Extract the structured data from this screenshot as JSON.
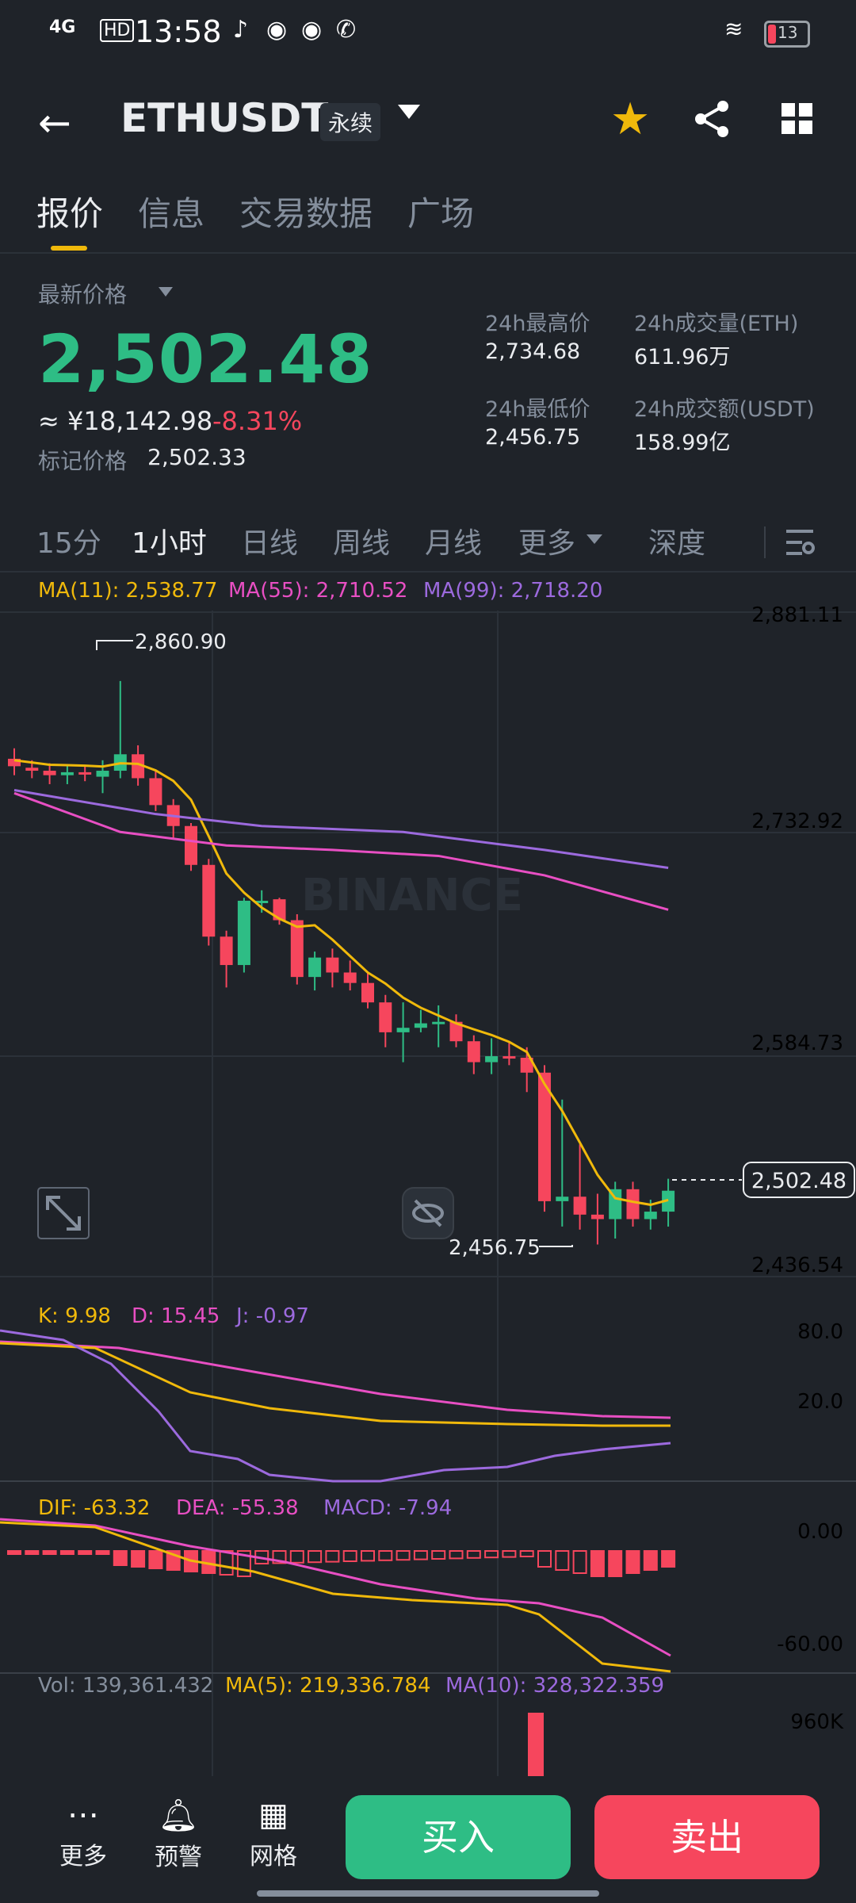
{
  "status": {
    "signal": "4G",
    "hd": "HD",
    "time": "13:58",
    "battery": "13"
  },
  "header": {
    "pair": "ETHUSDT",
    "contract_tag": "永续"
  },
  "tabs": [
    "报价",
    "信息",
    "交易数据",
    "广场"
  ],
  "quote": {
    "latest_label": "最新价格",
    "price": "2,502.48",
    "cny": "≈ ¥18,142.98",
    "change": "-8.31%",
    "mark_label": "标记价格",
    "mark_value": "2,502.33",
    "high_label": "24h最高价",
    "high_value": "2,734.68",
    "low_label": "24h最低价",
    "low_value": "2,456.75",
    "vol_label": "24h成交量(ETH)",
    "vol_value": "611.96万",
    "turnover_label": "24h成交额(USDT)",
    "turnover_value": "158.99亿"
  },
  "intervals": [
    "15分",
    "1小时",
    "日线",
    "周线",
    "月线",
    "更多",
    "深度"
  ],
  "colors": {
    "up": "#2ebd85",
    "down": "#f6465d",
    "accent": "#f0b90b",
    "ma11": "#f0b90b",
    "ma55": "#e84fc3",
    "ma99": "#9c6ade"
  },
  "chart_data": {
    "type": "candlestick",
    "ma_labels": {
      "ma11": "MA(11): 2,538.77",
      "ma55": "MA(55): 2,710.52",
      "ma99": "MA(99): 2,718.20"
    },
    "y_ticks": [
      "2,881.11",
      "2,732.92",
      "2,584.73",
      "2,436.54"
    ],
    "y_tick_values": [
      2881.11,
      2732.92,
      2584.73,
      2436.54
    ],
    "high_marker": "2,860.90",
    "low_marker": "2,456.75",
    "last_price": "2,502.48",
    "watermark": "BINANCE",
    "candles": [
      [
        2783,
        2778,
        2790,
        2772
      ],
      [
        2777,
        2775,
        2782,
        2770
      ],
      [
        2775,
        2772,
        2780,
        2766
      ],
      [
        2772,
        2774,
        2778,
        2766
      ],
      [
        2774,
        2773,
        2779,
        2768
      ],
      [
        2771,
        2775,
        2782,
        2760
      ],
      [
        2775,
        2786,
        2835,
        2770
      ],
      [
        2786,
        2770,
        2792,
        2765
      ],
      [
        2770,
        2752,
        2775,
        2748
      ],
      [
        2752,
        2738,
        2756,
        2730
      ],
      [
        2738,
        2712,
        2740,
        2708
      ],
      [
        2712,
        2664,
        2716,
        2658
      ],
      [
        2664,
        2645,
        2668,
        2630
      ],
      [
        2645,
        2688,
        2690,
        2640
      ],
      [
        2688,
        2688,
        2695,
        2680
      ],
      [
        2689,
        2675,
        2690,
        2672
      ],
      [
        2675,
        2637,
        2679,
        2632
      ],
      [
        2637,
        2650,
        2654,
        2628
      ],
      [
        2650,
        2640,
        2656,
        2630
      ],
      [
        2640,
        2633,
        2648,
        2628
      ],
      [
        2633,
        2620,
        2640,
        2616
      ],
      [
        2620,
        2600,
        2625,
        2590
      ],
      [
        2600,
        2603,
        2620,
        2580
      ],
      [
        2603,
        2606,
        2615,
        2600
      ],
      [
        2606,
        2607,
        2618,
        2590
      ],
      [
        2607,
        2594,
        2612,
        2590
      ],
      [
        2594,
        2580,
        2598,
        2572
      ],
      [
        2580,
        2584,
        2596,
        2572
      ],
      [
        2584,
        2583,
        2594,
        2578
      ],
      [
        2583,
        2573,
        2590,
        2560
      ],
      [
        2573,
        2487,
        2578,
        2480
      ],
      [
        2487,
        2490,
        2555,
        2470
      ],
      [
        2490,
        2478,
        2525,
        2468
      ],
      [
        2478,
        2475,
        2492,
        2458
      ],
      [
        2475,
        2495,
        2500,
        2462
      ],
      [
        2495,
        2475,
        2500,
        2470
      ],
      [
        2475,
        2480,
        2488,
        2468
      ],
      [
        2480,
        2494,
        2502,
        2470
      ]
    ],
    "kdj_labels": {
      "k": "K: 9.98",
      "d": "D: 15.45",
      "j": "J: -0.97"
    },
    "kdj_ticks": [
      "80.0",
      "20.0"
    ],
    "macd_labels": {
      "dif": "DIF: -63.32",
      "dea": "DEA: -55.38",
      "macd": "MACD: -7.94"
    },
    "macd_ticks": [
      "0.00",
      "-60.00"
    ],
    "vol_labels": {
      "vol": "Vol: 139,361.432",
      "ma5": "MA(5): 219,336.784",
      "ma10": "MA(10): 328,322.359"
    },
    "vol_ticks": [
      "960K"
    ]
  },
  "bottom": {
    "more": "更多",
    "alert": "预警",
    "grid": "网格",
    "buy": "买入",
    "sell": "卖出"
  }
}
